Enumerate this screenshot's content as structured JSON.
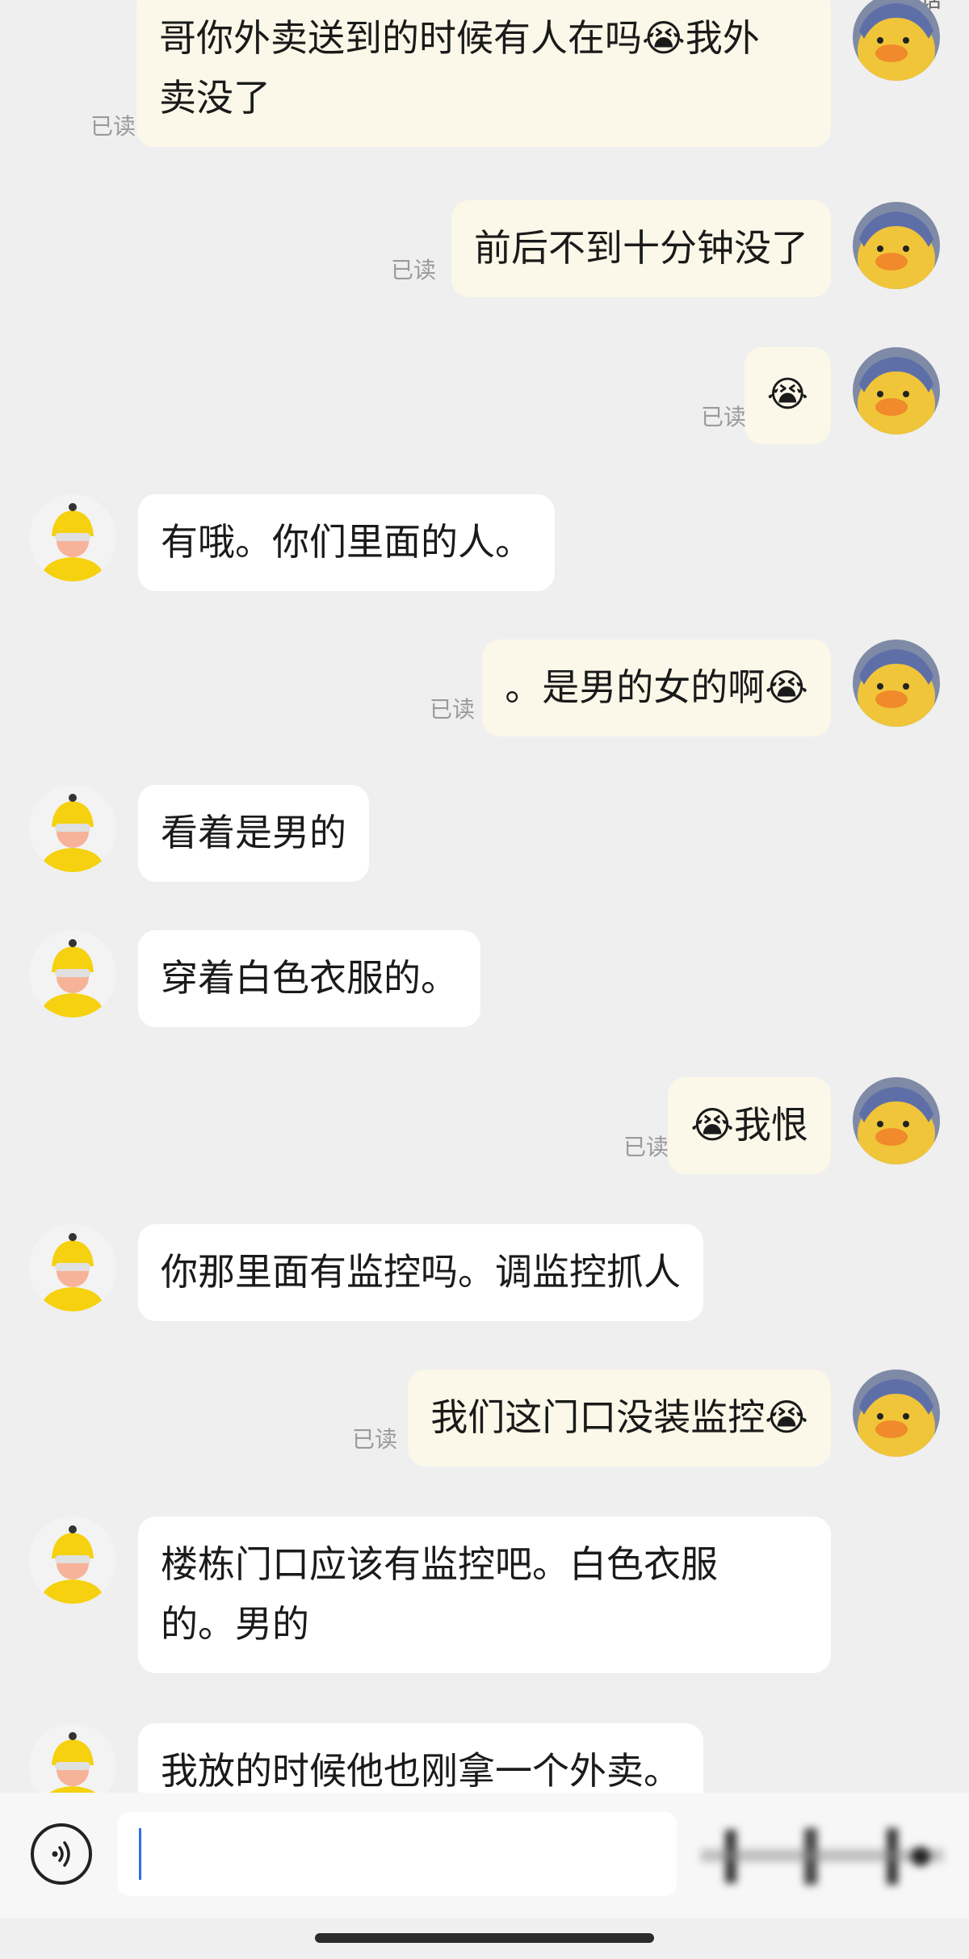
{
  "header": {
    "fragment": "电话"
  },
  "read_label": "已读",
  "messages": [
    {
      "side": "right",
      "lines": [
        "哥你外卖送到的时候有人在吗😭我外",
        "卖没了"
      ],
      "read": "已读"
    },
    {
      "side": "right",
      "text": "前后不到十分钟没了",
      "read": "已读"
    },
    {
      "side": "right",
      "text": "😭",
      "read": "已读"
    },
    {
      "side": "left",
      "text": "有哦。你们里面的人。"
    },
    {
      "side": "right",
      "text": "。是男的女的啊😭",
      "read": "已读"
    },
    {
      "side": "left",
      "text": "看着是男的"
    },
    {
      "side": "left",
      "text": "穿着白色衣服的。"
    },
    {
      "side": "right",
      "text": "😭我恨",
      "read": "已读"
    },
    {
      "side": "left",
      "text": "你那里面有监控吗。调监控抓人"
    },
    {
      "side": "right",
      "text": "我们这门口没装监控😭",
      "read": "已读"
    },
    {
      "side": "left",
      "lines": [
        "楼栋门口应该有监控吧。白色衣服",
        "的。男的"
      ]
    },
    {
      "side": "left",
      "text": "我放的时候他也刚拿一个外卖。"
    }
  ],
  "input": {
    "value": "",
    "placeholder": ""
  },
  "colors": {
    "background": "#efefef",
    "bubble_left": "#ffffff",
    "bubble_right": "#fbf8e9",
    "read_text": "#9a9a9a",
    "cursor": "#2f6fe5"
  },
  "icons": {
    "voice": "voice-icon",
    "self_avatar": "duck-avatar-icon",
    "courier_avatar": "courier-avatar-icon"
  }
}
